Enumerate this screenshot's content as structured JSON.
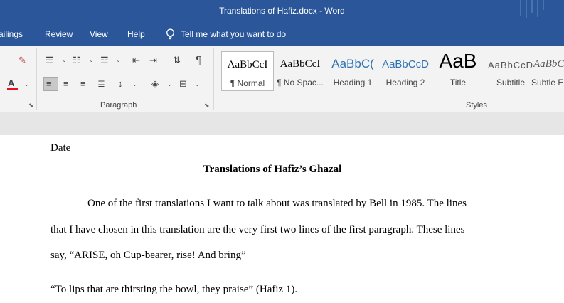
{
  "window": {
    "title": "Translations of Hafiz.docx  -  Word"
  },
  "menu": {
    "items": [
      "ailings",
      "Review",
      "View",
      "Help"
    ],
    "tell_me": "Tell me what you want to do"
  },
  "ribbon": {
    "groups": {
      "paragraph": "Paragraph",
      "styles": "Styles"
    },
    "styles": [
      {
        "sample": "AaBbCcI",
        "name": "¶ Normal"
      },
      {
        "sample": "AaBbCcI",
        "name": "¶ No Spac..."
      },
      {
        "sample": "AaBbC(",
        "name": "Heading 1"
      },
      {
        "sample": "AaBbCcD",
        "name": "Heading 2"
      },
      {
        "sample": "AaB",
        "name": "Title"
      },
      {
        "sample": "AaBbCcD",
        "name": "Subtitle"
      },
      {
        "sample": "AaBbCcL",
        "name": "Subtle Em"
      }
    ],
    "colors": {
      "font_color": "#e81123",
      "heading_blue": "#2e74b5"
    }
  },
  "document": {
    "date": "Date",
    "title": "Translations of Hafiz’s Ghazal",
    "lines": [
      "One of the first translations I want to talk about was translated by Bell in 1985. The lines",
      "that I have chosen in this translation are the very first two lines of the first paragraph. These lines",
      "say, “ARISE, oh Cup-bearer, rise! And bring”",
      "“To lips that are thirsting the bowl, they praise” (Hafiz 1)."
    ]
  }
}
